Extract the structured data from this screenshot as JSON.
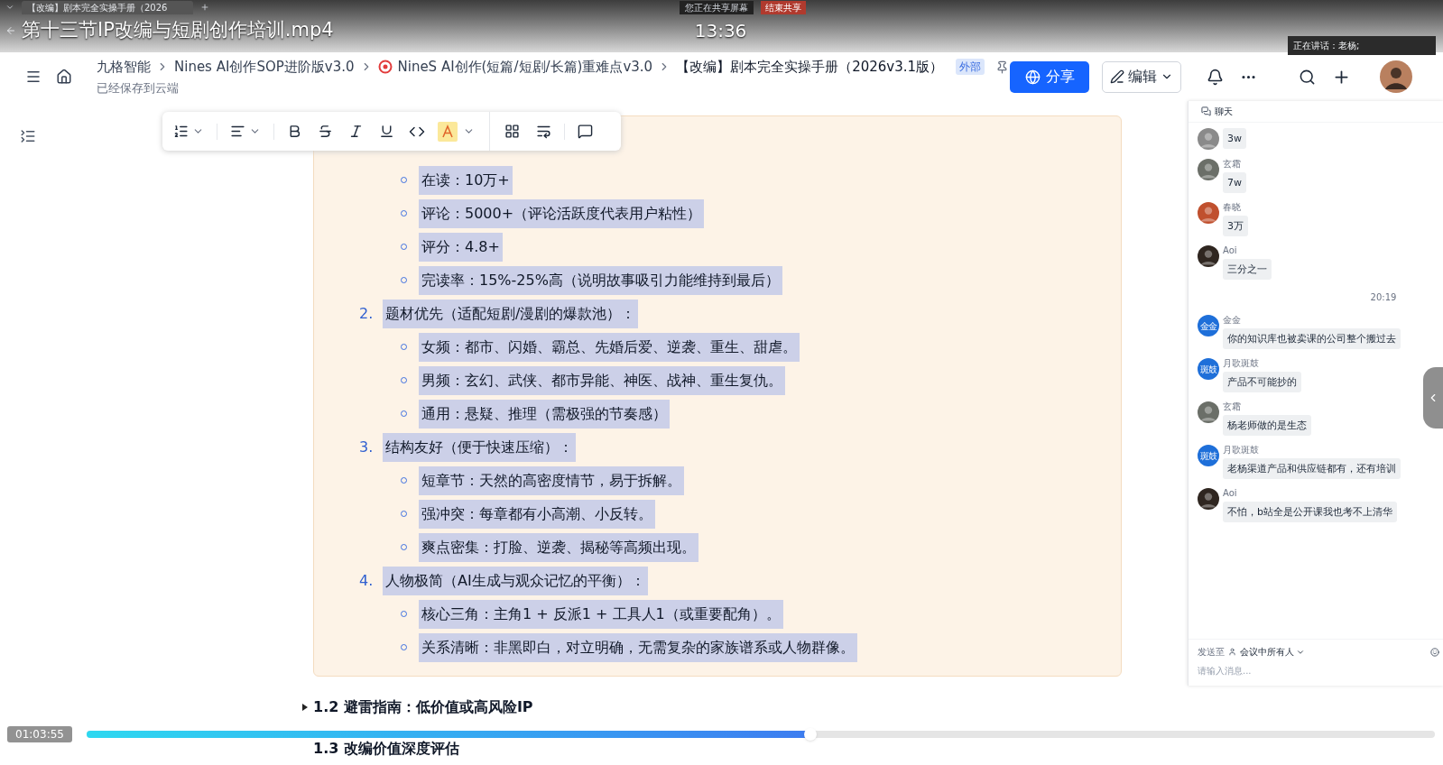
{
  "video": {
    "title": "第十三节IP改编与短剧创作培训.mp4",
    "clock": "13:36",
    "elapsed": "01:03:55",
    "level": 0.537
  },
  "browser": {
    "tab_title": "【改编】剧本完全实操手册（2026",
    "share_status": "您正在共享屏幕",
    "stop_share": "结束共享"
  },
  "header": {
    "breadcrumbs": [
      {
        "text": "九格智能",
        "kind": "plain"
      },
      {
        "text": "Nines AI创作SOP进阶版v3.0",
        "kind": "plain"
      },
      {
        "text": "NineS AI创作(短篇/短剧/长篇)重难点v3.0",
        "kind": "target"
      },
      {
        "text": "【改编】剧本完全实操手册（2026v3.1版）",
        "kind": "current"
      }
    ],
    "tag": "外部",
    "save_status": "已经保存到云端",
    "share": "分享",
    "edit": "编辑",
    "speaking": "正在讲话：老杨;"
  },
  "document": {
    "groups": [
      {
        "children": [
          {
            "text": "在读：10万+",
            "selected": true
          },
          {
            "text": "评论：5000+（评论活跃度代表用户粘性）",
            "selected": true
          },
          {
            "text": "评分：4.8+",
            "selected": true
          },
          {
            "text": "完读率：15%-25%高（说明故事吸引力能维持到最后）",
            "selected": true
          }
        ]
      },
      {
        "number": "2.",
        "text": "题材优先（适配短剧/漫剧的爆款池）：",
        "selected": true,
        "children": [
          {
            "text": "女频：都市、闪婚、霸总、先婚后爱、逆袭、重生、甜虐。",
            "selected": true
          },
          {
            "text": "男频：玄幻、武侠、都市异能、神医、战神、重生复仇。",
            "selected": true
          },
          {
            "text": "通用：悬疑、推理（需极强的节奏感）",
            "selected": true
          }
        ]
      },
      {
        "number": "3.",
        "text": "结构友好（便于快速压缩）：",
        "selected": true,
        "children": [
          {
            "text": "短章节：天然的高密度情节，易于拆解。",
            "selected": true
          },
          {
            "text": "强冲突：每章都有小高潮、小反转。",
            "selected": true
          },
          {
            "text": "爽点密集：打脸、逆袭、揭秘等高频出现。",
            "selected": true
          }
        ]
      },
      {
        "number": "4.",
        "text": "人物极简（AI生成与观众记忆的平衡）：",
        "selected": true,
        "children": [
          {
            "text": "核心三角：主角1 + 反派1 + 工具人1（或重要配角）。",
            "selected": true
          },
          {
            "text": "关系清晰：非黑即白，对立明确，无需复杂的家族谱系或人物群像。",
            "selected": true
          }
        ]
      }
    ],
    "sections": [
      {
        "title": "1.2 避雷指南：低价值或高风险IP",
        "collapsed": true
      },
      {
        "title": "1.3 改编价值深度评估",
        "collapsed": false
      }
    ]
  },
  "chat": {
    "title": "聊天",
    "messages": [
      {
        "kind": "message",
        "color": "#8a8a8a",
        "text": "3w"
      },
      {
        "kind": "message",
        "color": "#6b6f68",
        "name": "玄霜",
        "text": "7w"
      },
      {
        "kind": "message",
        "color": "#c0502e",
        "name": "春晓",
        "text": "3万"
      },
      {
        "kind": "message",
        "color": "#2f2620",
        "name": "Aoi",
        "text": "三分之一"
      },
      {
        "kind": "time",
        "text": "20:19"
      },
      {
        "kind": "message",
        "color": "#1e6fd9",
        "initials": "金金",
        "name": "金金",
        "text": "你的知识库也被卖课的公司整个搬过去"
      },
      {
        "kind": "message",
        "color": "#1e6fd9",
        "initials": "斑鼓",
        "name": "月歌斑鼓",
        "text": "产品不可能抄的"
      },
      {
        "kind": "message",
        "color": "#6b6f68",
        "name": "玄霜",
        "text": "杨老师做的是生态"
      },
      {
        "kind": "message",
        "color": "#1e6fd9",
        "initials": "斑鼓",
        "name": "月歌斑鼓",
        "text": "老杨渠道产品和供应链都有，还有培训"
      },
      {
        "kind": "message",
        "color": "#2f2620",
        "name": "Aoi",
        "text": "不怕，b站全是公开课我也考不上清华"
      }
    ],
    "send_to_label": "发送至",
    "send_to": "会议中所有人",
    "placeholder": "请输入消息..."
  }
}
